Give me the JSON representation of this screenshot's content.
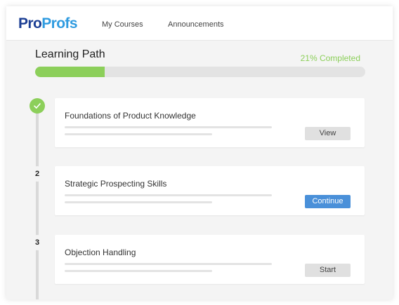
{
  "header": {
    "logo_part1": "Pro",
    "logo_part2": "Profs",
    "nav": [
      "My Courses",
      "Announcements"
    ]
  },
  "learning_path": {
    "title": "Learning Path",
    "status": "21% Completed",
    "progress_percent": 21
  },
  "steps": [
    {
      "marker": "checkmark-icon",
      "title": "Foundations of Product Knowledge",
      "button": "View"
    },
    {
      "marker": "2",
      "title": "Strategic Prospecting Skills",
      "button": "Continue"
    },
    {
      "marker": "3",
      "title": "Objection Handling",
      "button": "Start"
    }
  ],
  "colors": {
    "brand_dark": "#1c3f94",
    "brand_light": "#2f9be0",
    "progress_green": "#8ccf5a",
    "continue_blue": "#4a90d9"
  }
}
